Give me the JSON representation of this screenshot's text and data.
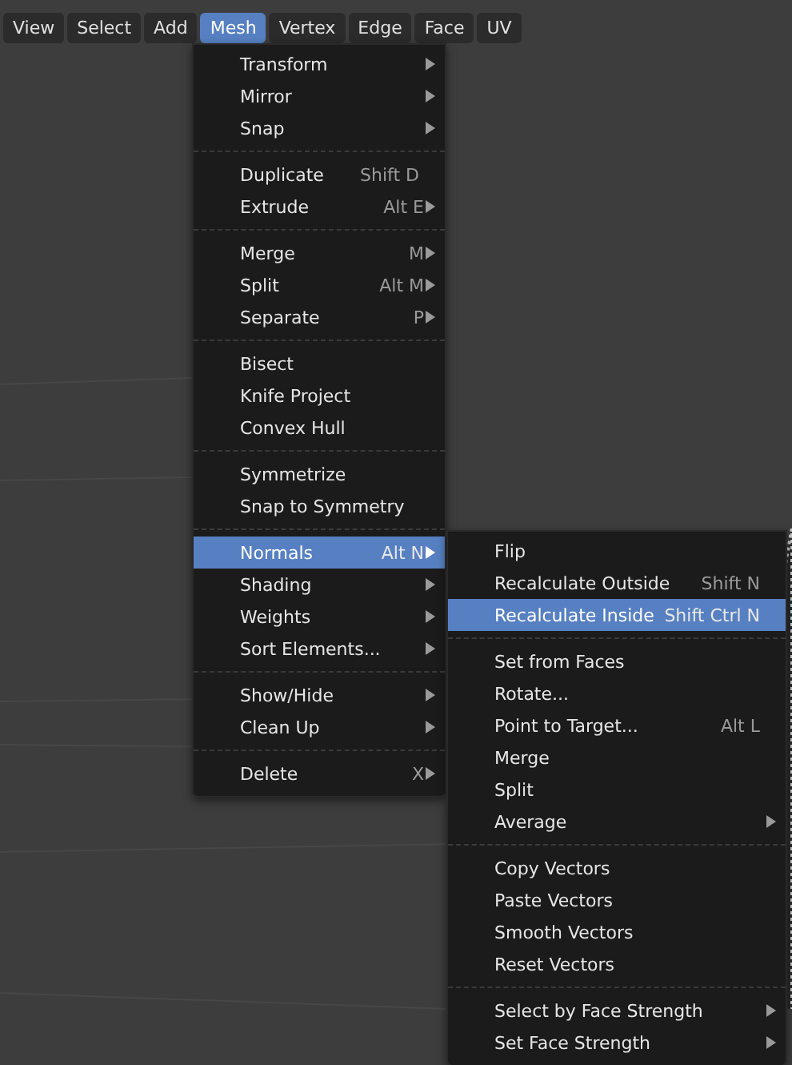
{
  "menubar": [
    {
      "label": "View",
      "selected": false
    },
    {
      "label": "Select",
      "selected": false
    },
    {
      "label": "Add",
      "selected": false
    },
    {
      "label": "Mesh",
      "selected": true
    },
    {
      "label": "Vertex",
      "selected": false
    },
    {
      "label": "Edge",
      "selected": false
    },
    {
      "label": "Face",
      "selected": false
    },
    {
      "label": "UV",
      "selected": false
    }
  ],
  "mesh_menu": [
    [
      {
        "label": "Transform",
        "submenu": true,
        "selected": false
      },
      {
        "label": "Mirror",
        "submenu": true,
        "selected": false
      },
      {
        "label": "Snap",
        "submenu": true,
        "selected": false
      }
    ],
    [
      {
        "label": "Duplicate",
        "shortcut": "Shift D",
        "submenu": false,
        "selected": false
      },
      {
        "label": "Extrude",
        "shortcut": "Alt E",
        "submenu": true,
        "selected": false
      }
    ],
    [
      {
        "label": "Merge",
        "shortcut": "M",
        "submenu": true,
        "selected": false
      },
      {
        "label": "Split",
        "shortcut": "Alt M",
        "submenu": true,
        "selected": false
      },
      {
        "label": "Separate",
        "shortcut": "P",
        "submenu": true,
        "selected": false
      }
    ],
    [
      {
        "label": "Bisect",
        "submenu": false,
        "selected": false
      },
      {
        "label": "Knife Project",
        "submenu": false,
        "selected": false
      },
      {
        "label": "Convex Hull",
        "submenu": false,
        "selected": false
      }
    ],
    [
      {
        "label": "Symmetrize",
        "submenu": false,
        "selected": false
      },
      {
        "label": "Snap to Symmetry",
        "submenu": false,
        "selected": false
      }
    ],
    [
      {
        "label": "Normals",
        "shortcut": "Alt N",
        "submenu": true,
        "selected": true
      },
      {
        "label": "Shading",
        "submenu": true,
        "selected": false
      },
      {
        "label": "Weights",
        "submenu": true,
        "selected": false
      },
      {
        "label": "Sort Elements...",
        "submenu": true,
        "selected": false
      }
    ],
    [
      {
        "label": "Show/Hide",
        "submenu": true,
        "selected": false
      },
      {
        "label": "Clean Up",
        "submenu": true,
        "selected": false
      }
    ],
    [
      {
        "label": "Delete",
        "shortcut": "X",
        "submenu": true,
        "selected": false
      }
    ]
  ],
  "normals_menu": [
    [
      {
        "label": "Flip",
        "submenu": false,
        "selected": false
      },
      {
        "label": "Recalculate Outside",
        "shortcut": "Shift N",
        "submenu": false,
        "selected": false
      },
      {
        "label": "Recalculate Inside",
        "shortcut": "Shift Ctrl N",
        "submenu": false,
        "selected": true
      }
    ],
    [
      {
        "label": "Set from Faces",
        "submenu": false,
        "selected": false
      },
      {
        "label": "Rotate...",
        "submenu": false,
        "selected": false
      },
      {
        "label": "Point to Target...",
        "shortcut": "Alt L",
        "submenu": false,
        "selected": false
      },
      {
        "label": "Merge",
        "submenu": false,
        "selected": false
      },
      {
        "label": "Split",
        "submenu": false,
        "selected": false
      },
      {
        "label": "Average",
        "submenu": true,
        "selected": false
      }
    ],
    [
      {
        "label": "Copy Vectors",
        "submenu": false,
        "selected": false
      },
      {
        "label": "Paste Vectors",
        "submenu": false,
        "selected": false
      },
      {
        "label": "Smooth Vectors",
        "submenu": false,
        "selected": false
      },
      {
        "label": "Reset Vectors",
        "submenu": false,
        "selected": false
      }
    ],
    [
      {
        "label": "Select by Face Strength",
        "submenu": true,
        "selected": false
      },
      {
        "label": "Set Face Strength",
        "submenu": true,
        "selected": false
      }
    ]
  ]
}
